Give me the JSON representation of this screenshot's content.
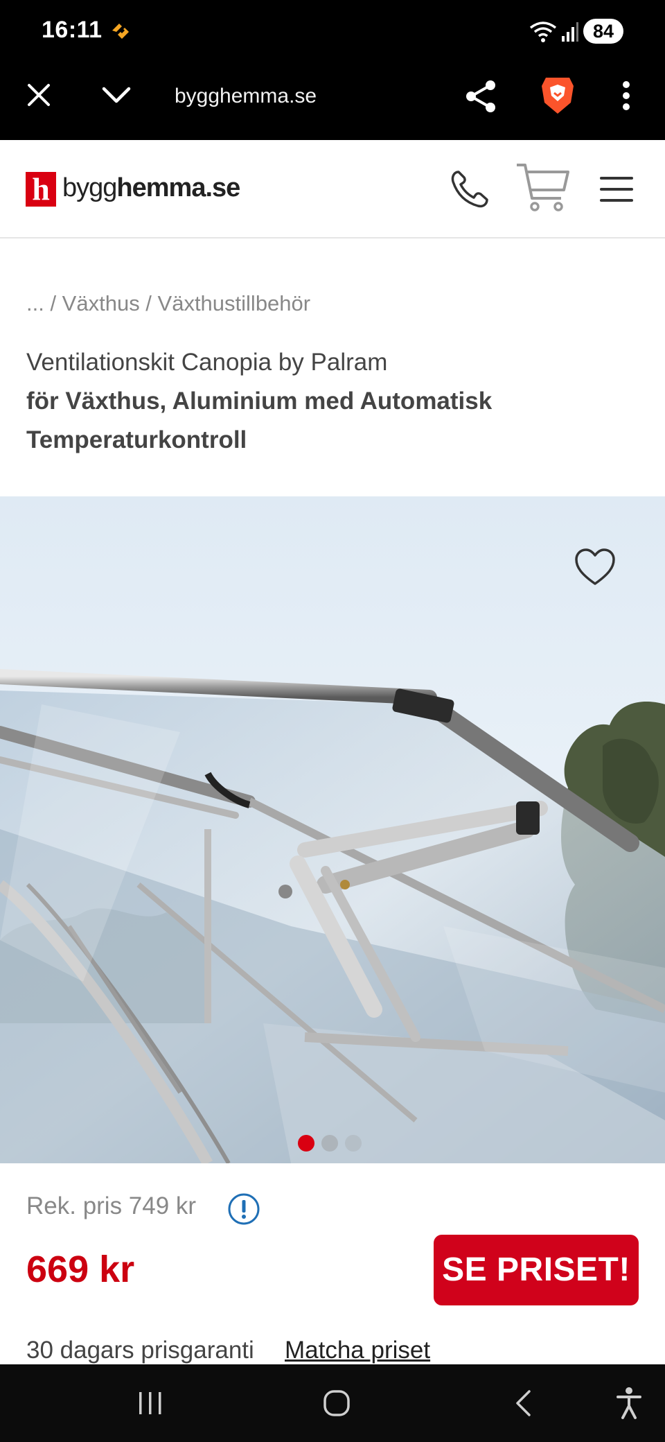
{
  "status_bar": {
    "time": "16:11",
    "battery": "84",
    "app_icon": "brave-wallet-icon",
    "wifi_icon": "wifi-icon",
    "signal_icon": "signal-icon"
  },
  "browser": {
    "url": "bygghemma.se",
    "icons": [
      "close-icon",
      "chevron-down-icon",
      "share-icon",
      "brave-lion-icon",
      "more-vertical-icon"
    ]
  },
  "site_header": {
    "logo_mark": "h",
    "logo_text_regular": "bygg",
    "logo_text_bold": "hemma.se",
    "icons": [
      "phone-icon",
      "cart-icon",
      "menu-icon"
    ]
  },
  "breadcrumb": "... / Växthus / Växthustillbehör",
  "product": {
    "brand_line": "Ventilationskit Canopia by Palram",
    "title_line1": "för Växthus, Aluminium med Automatisk",
    "title_line2": "Temperaturkontroll"
  },
  "gallery": {
    "active_index": 1,
    "total_dots": 3,
    "favorite_icon": "heart-icon"
  },
  "pricing": {
    "recommended": "Rek. pris 749 kr",
    "price": "669 kr",
    "cta_label": "SE PRISET!",
    "guarantee": "30 dagars prisgaranti",
    "match_link": "Matcha priset"
  },
  "colors": {
    "brand_red": "#d0021b",
    "price_red": "#cc0010",
    "text": "#444444",
    "muted": "#888888",
    "info_blue": "#1f6fb5"
  },
  "nav_bar": {
    "icons": [
      "recents-icon",
      "home-icon",
      "back-icon",
      "accessibility-icon"
    ]
  }
}
